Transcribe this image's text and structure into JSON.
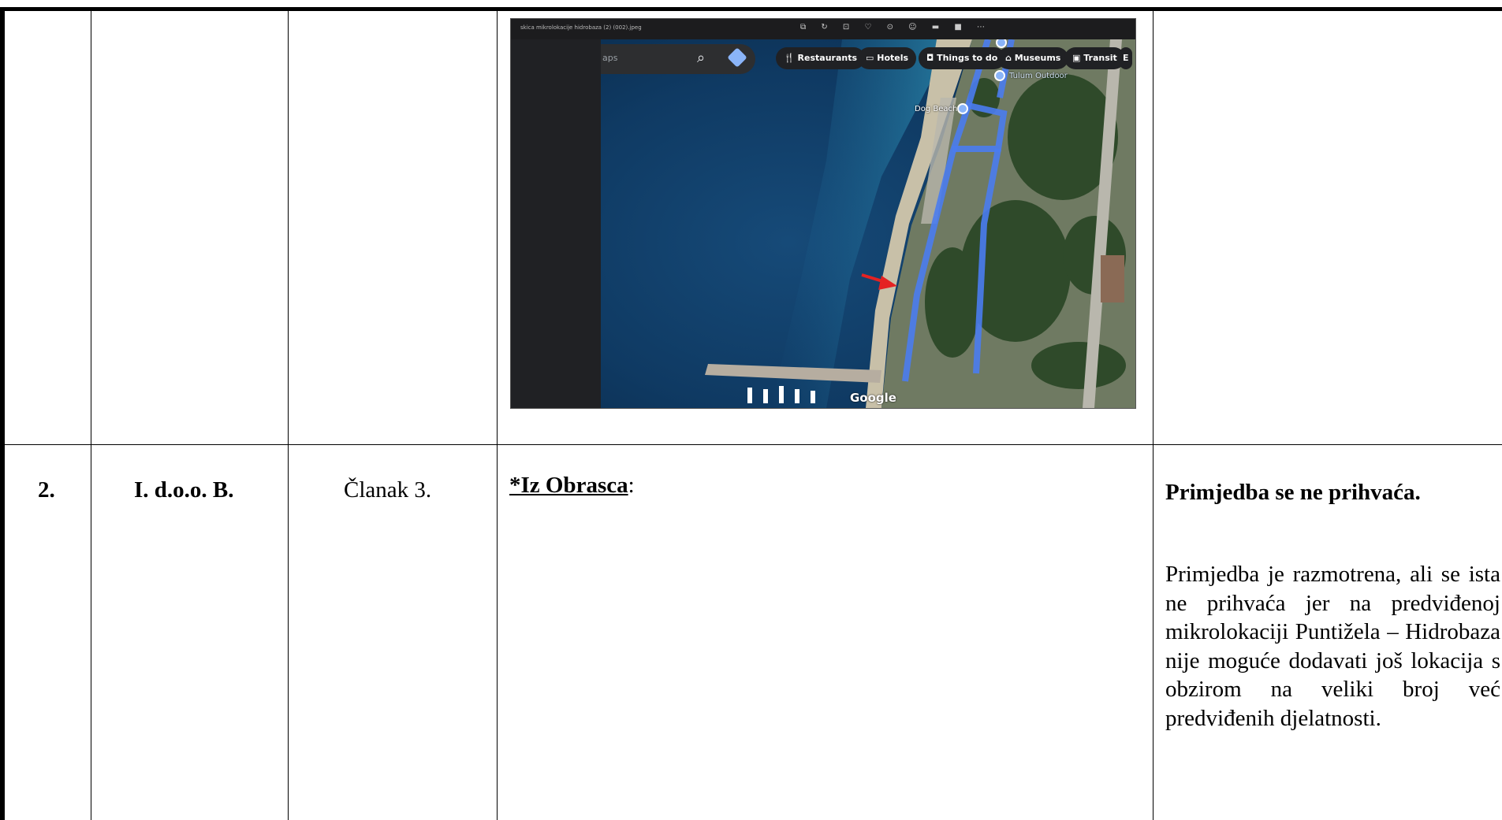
{
  "table": {
    "row2": {
      "number": "2.",
      "submitter": "I. d.o.o. B.",
      "article": "Članak 3.",
      "comment_heading": "*Iz Obrasca",
      "comment_colon": ":",
      "decision_title": "Primjedba se ne prihvaća.",
      "decision_text": "Primjedba je razmotrena, ali se ista ne prihvaća jer na predviđenoj mikrolokaciji Puntižela – Hidrobaza nije moguće dodavati još lokacija s obzirom na veliki broj već predviđenih djelatnosti."
    }
  },
  "map_screenshot": {
    "file_name": "skica mikrolokacije hidrobaza (2) (002).jpeg",
    "search_text": "aps",
    "chips": [
      "Restaurants",
      "Hotels",
      "Things to do",
      "Museums",
      "Transit",
      "E"
    ],
    "labels": {
      "dog_beach": "Dog Beach",
      "outdoor": "Tulum Outdoor",
      "google": "Google"
    },
    "colors": {
      "sea": "#123a5e",
      "route": "#4a7cf0",
      "arrow": "#e52222"
    }
  }
}
